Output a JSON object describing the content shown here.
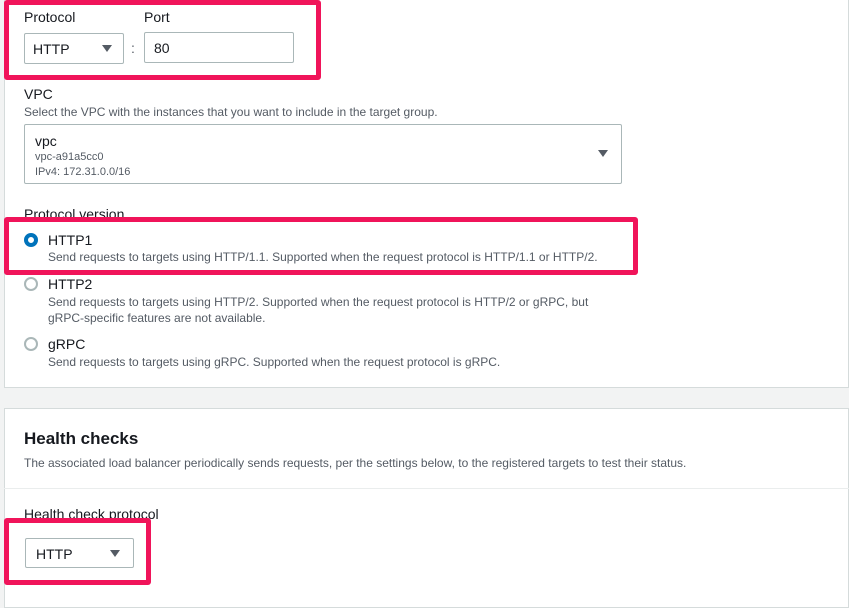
{
  "listener": {
    "protocol_label": "Protocol",
    "port_label": "Port",
    "protocol_value": "HTTP",
    "separator": ":",
    "port_value": "80"
  },
  "vpc": {
    "label": "VPC",
    "description": "Select the VPC with the instances that you want to include in the target group.",
    "name": "vpc",
    "id": "vpc-a91a5cc0",
    "cidr": "IPv4: 172.31.0.0/16"
  },
  "protocol_version": {
    "label": "Protocol version",
    "options": [
      {
        "label": "HTTP1",
        "description": "Send requests to targets using HTTP/1.1. Supported when the request protocol is HTTP/1.1 or HTTP/2.",
        "selected": true
      },
      {
        "label": "HTTP2",
        "description": "Send requests to targets using HTTP/2. Supported when the request protocol is HTTP/2 or gRPC, but",
        "description2": "gRPC-specific features are not available.",
        "selected": false
      },
      {
        "label": "gRPC",
        "description": "Send requests to targets using gRPC. Supported when the request protocol is gRPC.",
        "selected": false
      }
    ]
  },
  "health_checks": {
    "title": "Health checks",
    "description": "The associated load balancer periodically sends requests, per the settings below, to the registered targets to test their status.",
    "protocol_label": "Health check protocol",
    "protocol_value": "HTTP"
  },
  "colors": {
    "highlight": "#f0145a",
    "accent": "#0073bb"
  }
}
